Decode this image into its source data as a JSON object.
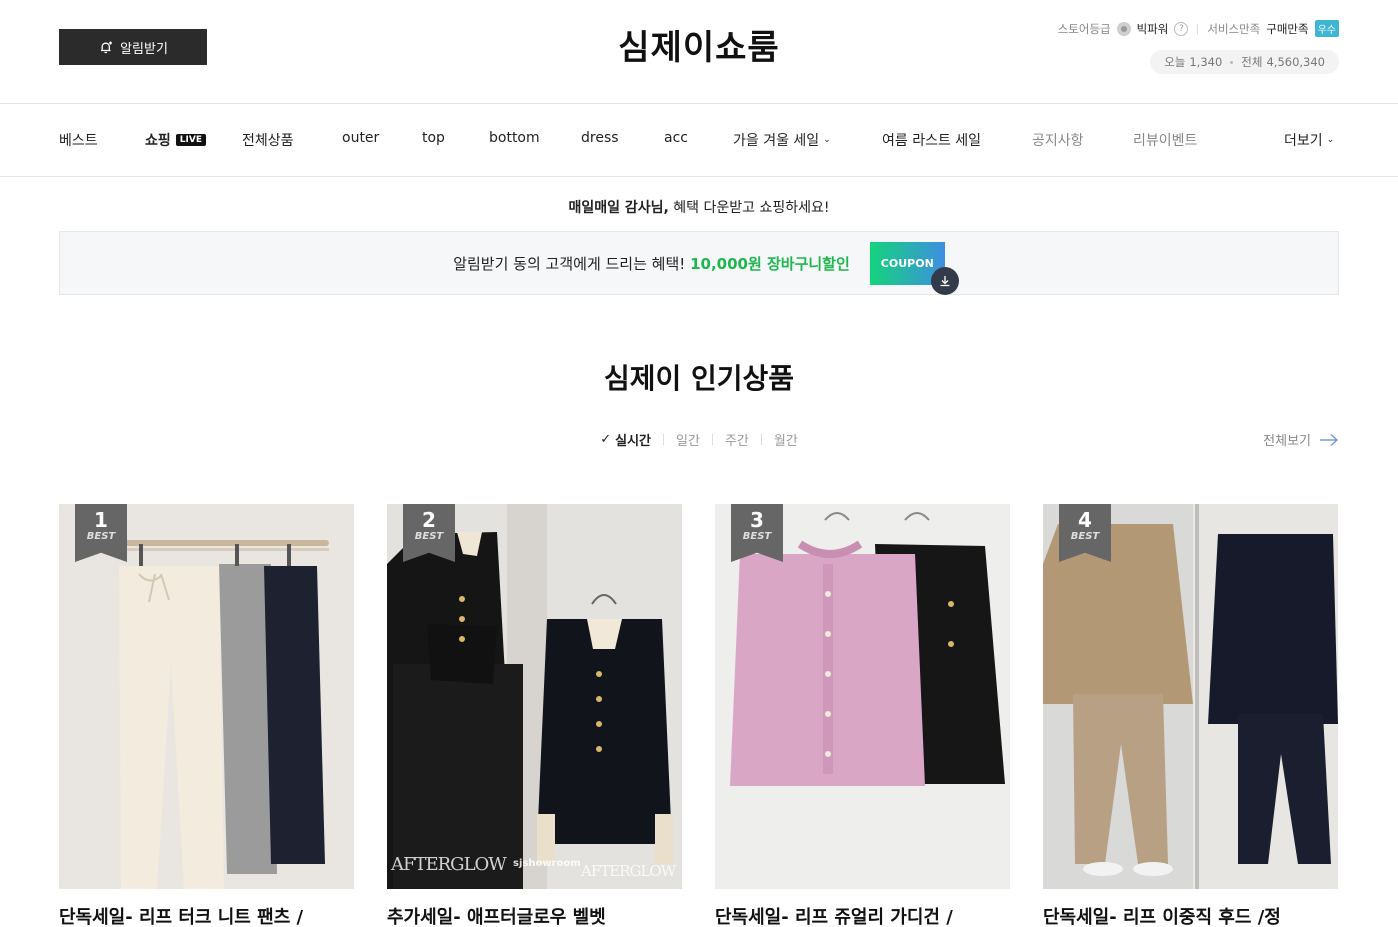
{
  "header": {
    "notify_label": "알림받기",
    "logo": "심제이쇼룸",
    "store_grade_label": "스토어등급",
    "store_grade_value": "빅파워",
    "service_label": "서비스만족",
    "purchase_label": "구매만족",
    "purchase_badge": "우수",
    "today_label": "오늘",
    "today_count": "1,340",
    "total_label": "전체",
    "total_count": "4,560,340"
  },
  "nav": {
    "items": [
      {
        "label": "베스트"
      },
      {
        "label": "쇼핑",
        "badge": "LIVE"
      },
      {
        "label": "전체상품"
      },
      {
        "label": "outer"
      },
      {
        "label": "top"
      },
      {
        "label": "bottom"
      },
      {
        "label": "dress"
      },
      {
        "label": "acc"
      },
      {
        "label": "가을 겨울 세일"
      },
      {
        "label": "여름 라스트 세일"
      },
      {
        "label": "공지사항"
      },
      {
        "label": "리뷰이벤트"
      }
    ],
    "more_label": "더보기"
  },
  "welcome": {
    "name": "매일매일 감사님,",
    "message": " 혜택 다운받고 쇼핑하세요!"
  },
  "coupon": {
    "text": "알림받기 동의 고객에게 드리는 혜택!",
    "highlight": "10,000원 장바구니할인",
    "button_label": "COUPON"
  },
  "section": {
    "title": "심제이 인기상품",
    "tabs": [
      "실시간",
      "일간",
      "주간",
      "월간"
    ],
    "see_all": "전체보기"
  },
  "products": [
    {
      "rank": "1",
      "best": "BEST",
      "name": "단독세일- 리프 터크 니트 팬츠 /"
    },
    {
      "rank": "2",
      "best": "BEST",
      "name": "추가세일- 애프터글로우 벨벳",
      "watermark": "AFTERGLOW",
      "watermark2": "sjshowroom"
    },
    {
      "rank": "3",
      "best": "BEST",
      "name": "단독세일- 리프 쥬얼리 가디건 /"
    },
    {
      "rank": "4",
      "best": "BEST",
      "name": "단독세일- 리프 이중직 후드 /정"
    }
  ],
  "colors": {
    "accent_green": "#1fb64f",
    "notify_bg": "#2b2b2b",
    "badge_blue": "#3fb5d4"
  }
}
